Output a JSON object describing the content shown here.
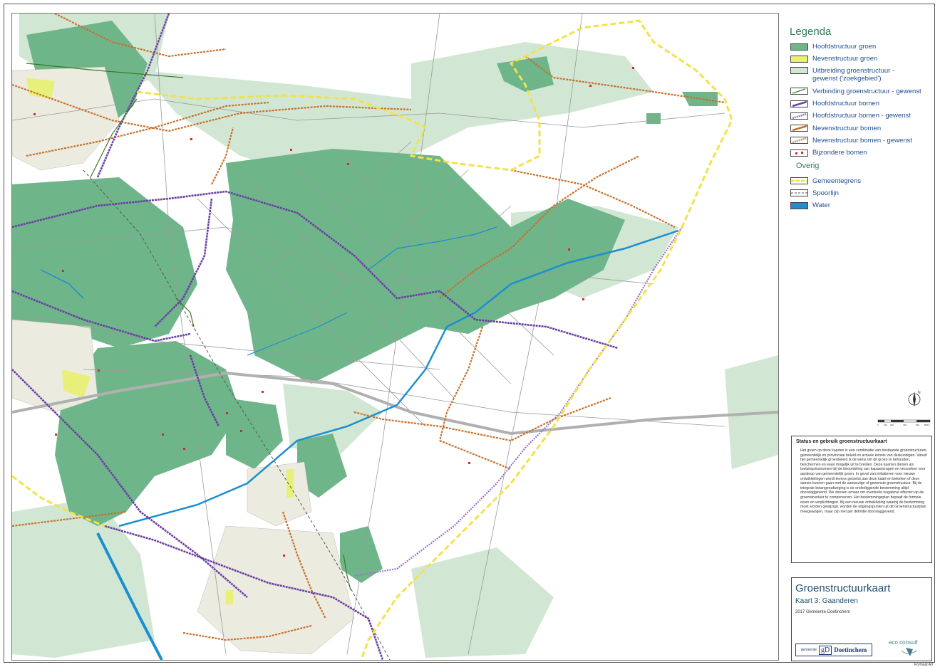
{
  "legend": {
    "title": "Legenda",
    "items": [
      {
        "label": "Hoofdstructuur groen",
        "color": "#6fb58a"
      },
      {
        "label": "Nevenstructuur groen",
        "color": "#e8f07a"
      },
      {
        "label": "Uitbreiding groenstructuur -\ngewenst ('zoekgebied')",
        "color": "#d2e6d4"
      },
      {
        "label": "Verbinding groenstructuur - gewenst",
        "color": "#3a7a26"
      },
      {
        "label": "Hoofdstructuur bomen",
        "color": "#6a3fa3"
      },
      {
        "label": "Hoofdstructuur bomen - gewenst",
        "color": "#9c6fcf"
      },
      {
        "label": "Nevenstructuur bomen",
        "color": "#c8702a"
      },
      {
        "label": "Nevenstructuur bomen - gewenst",
        "color": "#d8955a"
      },
      {
        "label": "Bijzondere bomen",
        "color": "#d12b2b"
      }
    ],
    "other_title": "Overig",
    "other_items": [
      {
        "label": "Gemeentegrens",
        "color": "#f2e24a"
      },
      {
        "label": "Spoorlijn",
        "color": "#555555"
      },
      {
        "label": "Water",
        "color": "#1b8fd0"
      }
    ]
  },
  "status": {
    "heading": "Status en gebruik groenstructuurkaart",
    "body": "Het groen op deze kaarten is een combinatie van bestaande groenstructuren, gemeentelijk en provinciaal beleid en actuele kennis van deskundigen. Vanuit het gemeentelijk groenbeleid is de wens om dit groen te behouden, beschermen en waar mogelijk uit te breiden. Deze kaarten dienen als toetsingsinstrument bij de beoordeling van kapaanvragen en verzoeken voor aankoop van gemeentelijk groen. In geval van initiatieven voor nieuwe ontwikkelingen wordt tevens getoetst aan deze kaart en bekeken of deze samen kunnen gaan met de aanwezige of gewenste groenstructuur. Bij de integrale belangenafweging is de onderliggende bestemming altijd doorslaggevend. We streven ernaar om eventuele negatieve effecten op de groenstructuur te compenseren. Het bestemmingsplan bepaalt de formele eisen en verplichtingen. Bij een nieuwe ontwikkeling waarbij de bestemming moet worden gewijzigd, worden de uitgangspunten uit dit Groenstructuurplan meegewogen, maar zijn niet per definitie doorslaggevend."
  },
  "titlebox": {
    "title": "Groenstructuurkaart",
    "subtitle": "Kaart 3: Gaanderen",
    "year": "2017 Gemeente Doetinchem"
  },
  "logos": {
    "gemeente_small": "gemeente",
    "gemeente_mark": "gD",
    "gemeente_name": "Doetinchem",
    "consultant": "eco consult"
  },
  "north_label": "N",
  "scale": {
    "labels": [
      "0",
      "100",
      "200",
      "400",
      "600",
      "800m"
    ]
  },
  "format": "Formaat A0"
}
